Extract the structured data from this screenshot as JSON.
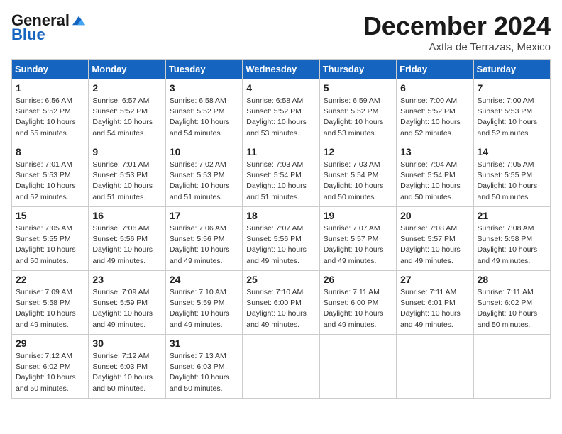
{
  "header": {
    "logo_general": "General",
    "logo_blue": "Blue",
    "month_title": "December 2024",
    "subtitle": "Axtla de Terrazas, Mexico"
  },
  "calendar": {
    "days_of_week": [
      "Sunday",
      "Monday",
      "Tuesday",
      "Wednesday",
      "Thursday",
      "Friday",
      "Saturday"
    ],
    "weeks": [
      [
        null,
        {
          "day": "2",
          "sunrise": "Sunrise: 6:57 AM",
          "sunset": "Sunset: 5:52 PM",
          "daylight": "Daylight: 10 hours and 54 minutes."
        },
        {
          "day": "3",
          "sunrise": "Sunrise: 6:58 AM",
          "sunset": "Sunset: 5:52 PM",
          "daylight": "Daylight: 10 hours and 54 minutes."
        },
        {
          "day": "4",
          "sunrise": "Sunrise: 6:58 AM",
          "sunset": "Sunset: 5:52 PM",
          "daylight": "Daylight: 10 hours and 53 minutes."
        },
        {
          "day": "5",
          "sunrise": "Sunrise: 6:59 AM",
          "sunset": "Sunset: 5:52 PM",
          "daylight": "Daylight: 10 hours and 53 minutes."
        },
        {
          "day": "6",
          "sunrise": "Sunrise: 7:00 AM",
          "sunset": "Sunset: 5:52 PM",
          "daylight": "Daylight: 10 hours and 52 minutes."
        },
        {
          "day": "7",
          "sunrise": "Sunrise: 7:00 AM",
          "sunset": "Sunset: 5:53 PM",
          "daylight": "Daylight: 10 hours and 52 minutes."
        }
      ],
      [
        {
          "day": "1",
          "sunrise": "Sunrise: 6:56 AM",
          "sunset": "Sunset: 5:52 PM",
          "daylight": "Daylight: 10 hours and 55 minutes."
        },
        null,
        null,
        null,
        null,
        null,
        null
      ],
      [
        {
          "day": "8",
          "sunrise": "Sunrise: 7:01 AM",
          "sunset": "Sunset: 5:53 PM",
          "daylight": "Daylight: 10 hours and 52 minutes."
        },
        {
          "day": "9",
          "sunrise": "Sunrise: 7:01 AM",
          "sunset": "Sunset: 5:53 PM",
          "daylight": "Daylight: 10 hours and 51 minutes."
        },
        {
          "day": "10",
          "sunrise": "Sunrise: 7:02 AM",
          "sunset": "Sunset: 5:53 PM",
          "daylight": "Daylight: 10 hours and 51 minutes."
        },
        {
          "day": "11",
          "sunrise": "Sunrise: 7:03 AM",
          "sunset": "Sunset: 5:54 PM",
          "daylight": "Daylight: 10 hours and 51 minutes."
        },
        {
          "day": "12",
          "sunrise": "Sunrise: 7:03 AM",
          "sunset": "Sunset: 5:54 PM",
          "daylight": "Daylight: 10 hours and 50 minutes."
        },
        {
          "day": "13",
          "sunrise": "Sunrise: 7:04 AM",
          "sunset": "Sunset: 5:54 PM",
          "daylight": "Daylight: 10 hours and 50 minutes."
        },
        {
          "day": "14",
          "sunrise": "Sunrise: 7:05 AM",
          "sunset": "Sunset: 5:55 PM",
          "daylight": "Daylight: 10 hours and 50 minutes."
        }
      ],
      [
        {
          "day": "15",
          "sunrise": "Sunrise: 7:05 AM",
          "sunset": "Sunset: 5:55 PM",
          "daylight": "Daylight: 10 hours and 50 minutes."
        },
        {
          "day": "16",
          "sunrise": "Sunrise: 7:06 AM",
          "sunset": "Sunset: 5:56 PM",
          "daylight": "Daylight: 10 hours and 49 minutes."
        },
        {
          "day": "17",
          "sunrise": "Sunrise: 7:06 AM",
          "sunset": "Sunset: 5:56 PM",
          "daylight": "Daylight: 10 hours and 49 minutes."
        },
        {
          "day": "18",
          "sunrise": "Sunrise: 7:07 AM",
          "sunset": "Sunset: 5:56 PM",
          "daylight": "Daylight: 10 hours and 49 minutes."
        },
        {
          "day": "19",
          "sunrise": "Sunrise: 7:07 AM",
          "sunset": "Sunset: 5:57 PM",
          "daylight": "Daylight: 10 hours and 49 minutes."
        },
        {
          "day": "20",
          "sunrise": "Sunrise: 7:08 AM",
          "sunset": "Sunset: 5:57 PM",
          "daylight": "Daylight: 10 hours and 49 minutes."
        },
        {
          "day": "21",
          "sunrise": "Sunrise: 7:08 AM",
          "sunset": "Sunset: 5:58 PM",
          "daylight": "Daylight: 10 hours and 49 minutes."
        }
      ],
      [
        {
          "day": "22",
          "sunrise": "Sunrise: 7:09 AM",
          "sunset": "Sunset: 5:58 PM",
          "daylight": "Daylight: 10 hours and 49 minutes."
        },
        {
          "day": "23",
          "sunrise": "Sunrise: 7:09 AM",
          "sunset": "Sunset: 5:59 PM",
          "daylight": "Daylight: 10 hours and 49 minutes."
        },
        {
          "day": "24",
          "sunrise": "Sunrise: 7:10 AM",
          "sunset": "Sunset: 5:59 PM",
          "daylight": "Daylight: 10 hours and 49 minutes."
        },
        {
          "day": "25",
          "sunrise": "Sunrise: 7:10 AM",
          "sunset": "Sunset: 6:00 PM",
          "daylight": "Daylight: 10 hours and 49 minutes."
        },
        {
          "day": "26",
          "sunrise": "Sunrise: 7:11 AM",
          "sunset": "Sunset: 6:00 PM",
          "daylight": "Daylight: 10 hours and 49 minutes."
        },
        {
          "day": "27",
          "sunrise": "Sunrise: 7:11 AM",
          "sunset": "Sunset: 6:01 PM",
          "daylight": "Daylight: 10 hours and 49 minutes."
        },
        {
          "day": "28",
          "sunrise": "Sunrise: 7:11 AM",
          "sunset": "Sunset: 6:02 PM",
          "daylight": "Daylight: 10 hours and 50 minutes."
        }
      ],
      [
        {
          "day": "29",
          "sunrise": "Sunrise: 7:12 AM",
          "sunset": "Sunset: 6:02 PM",
          "daylight": "Daylight: 10 hours and 50 minutes."
        },
        {
          "day": "30",
          "sunrise": "Sunrise: 7:12 AM",
          "sunset": "Sunset: 6:03 PM",
          "daylight": "Daylight: 10 hours and 50 minutes."
        },
        {
          "day": "31",
          "sunrise": "Sunrise: 7:13 AM",
          "sunset": "Sunset: 6:03 PM",
          "daylight": "Daylight: 10 hours and 50 minutes."
        },
        null,
        null,
        null,
        null
      ]
    ]
  }
}
